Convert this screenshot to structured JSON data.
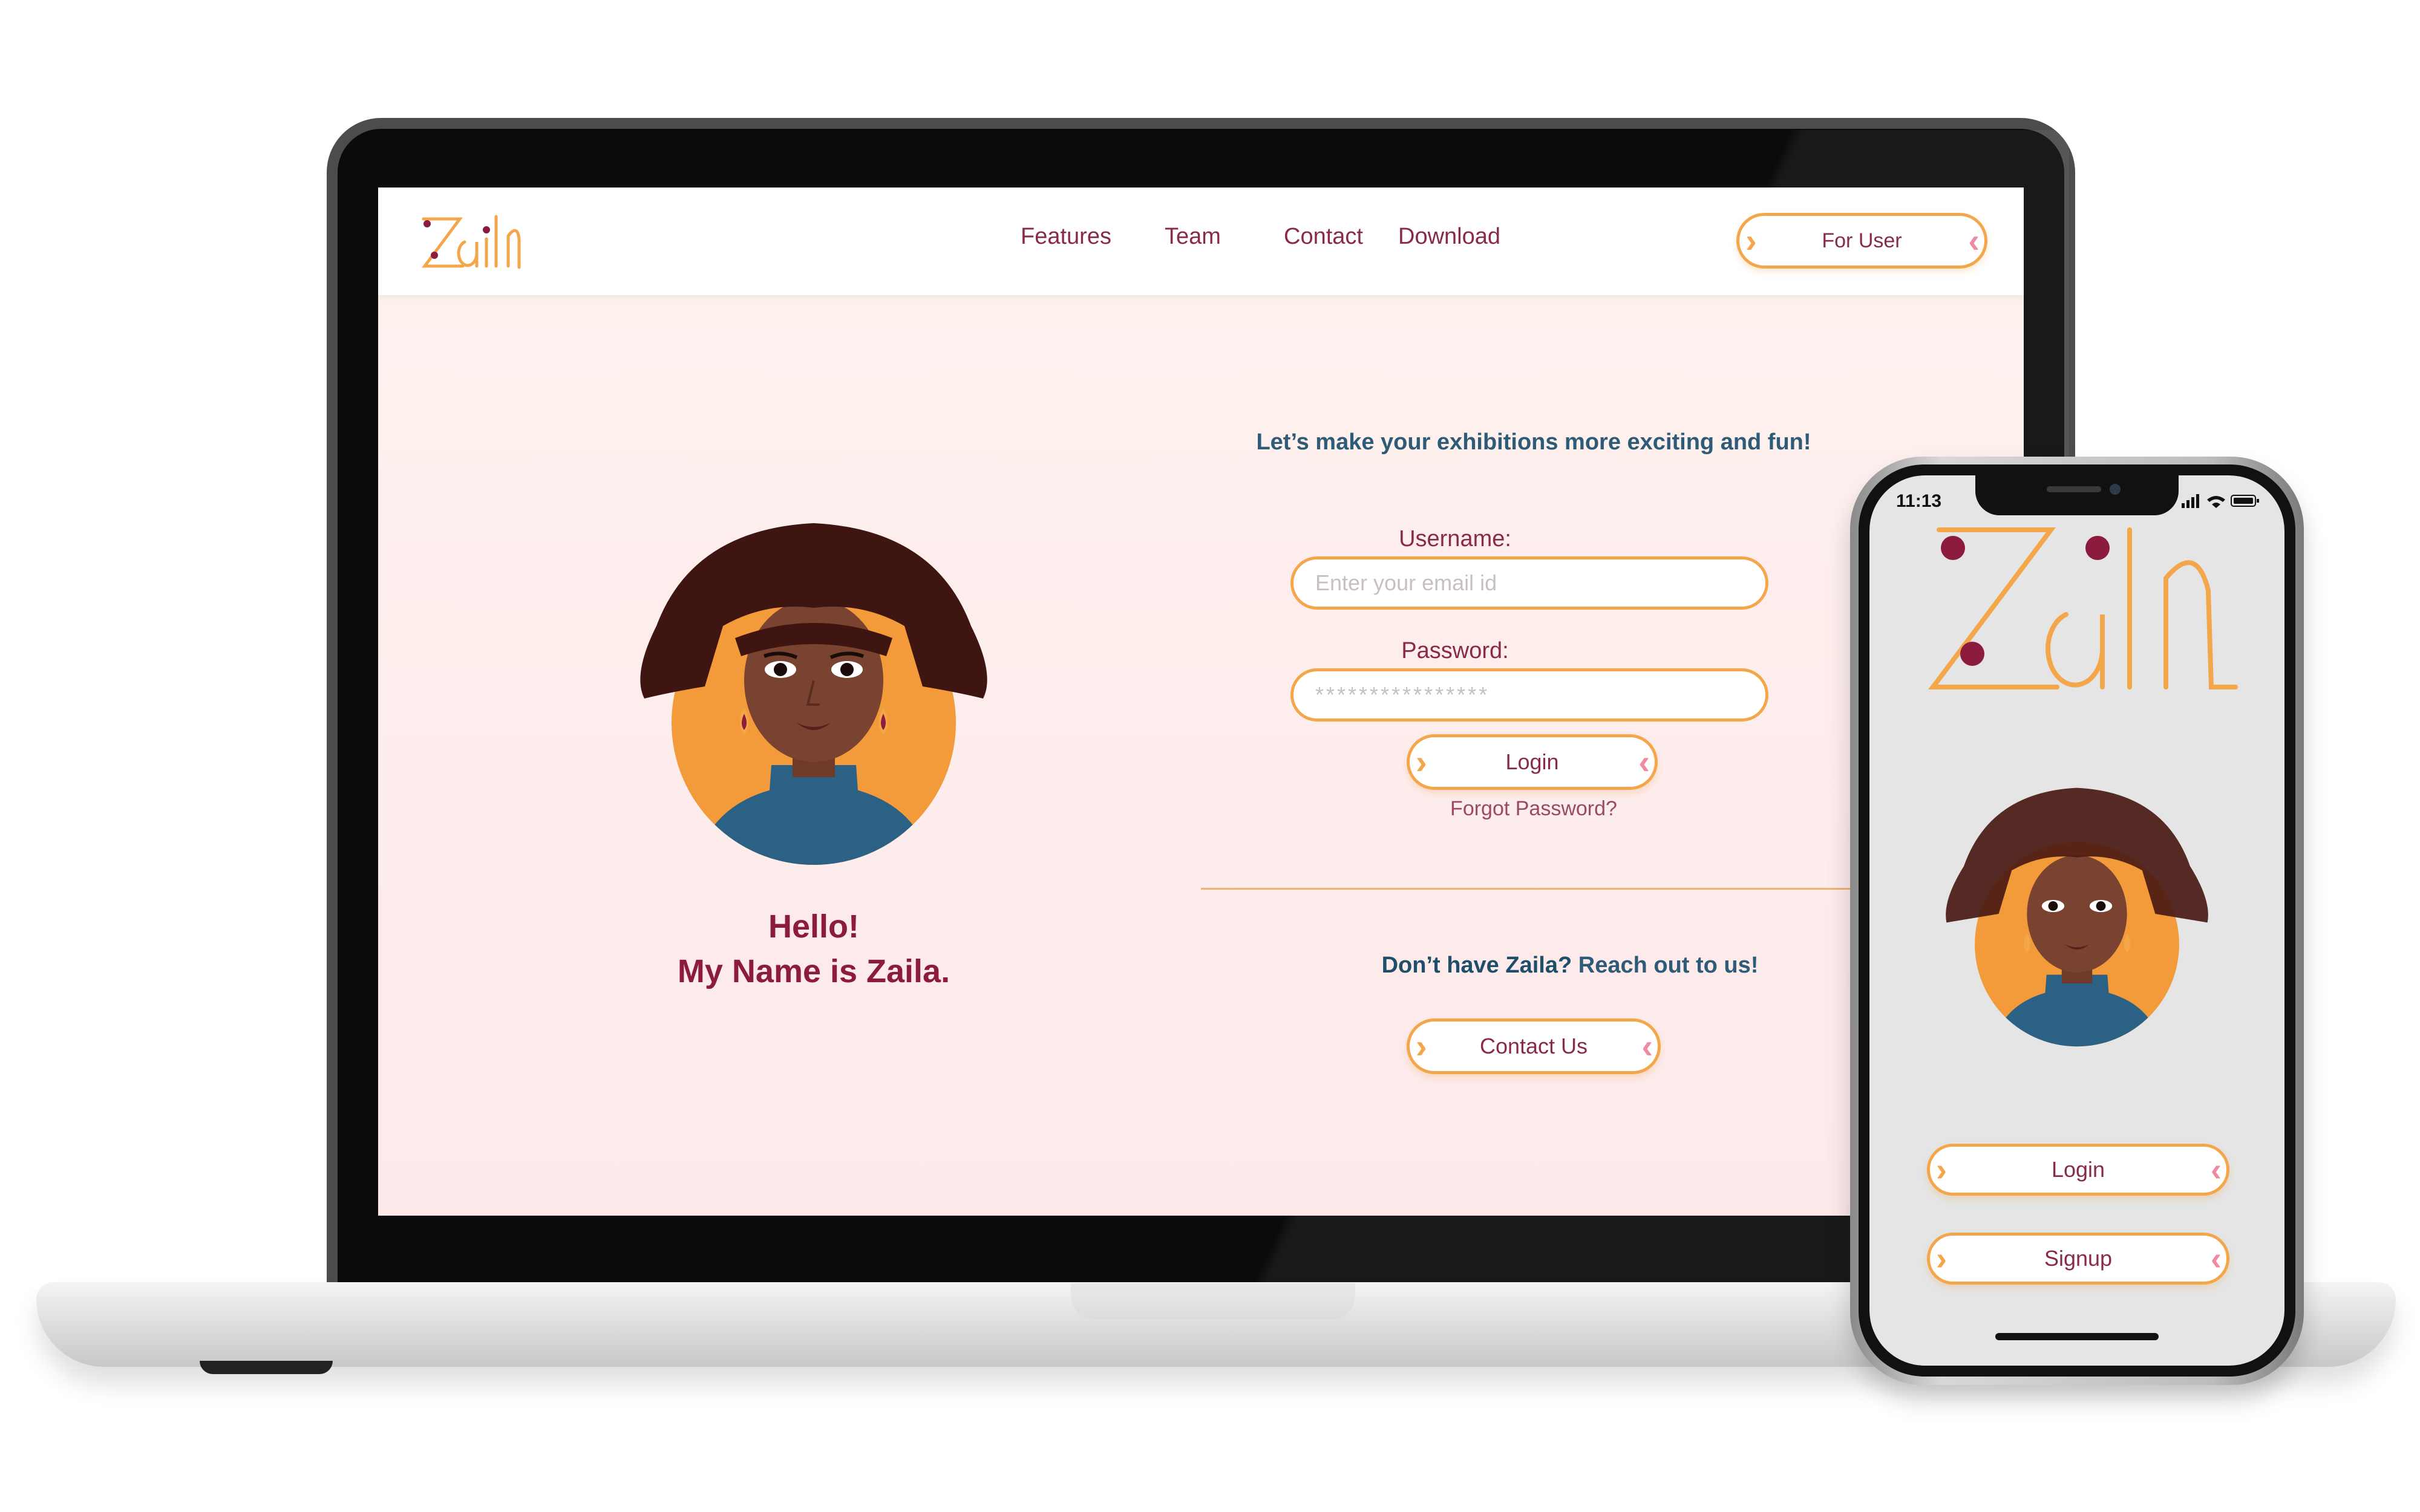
{
  "colors": {
    "brand_orange": "#f3a64a",
    "brand_maroon": "#8b1c3d",
    "accent_blue": "#2d5b78",
    "accent_pink": "#ef8aa0",
    "screen_bg": "#fdecec"
  },
  "website": {
    "logo_text": "Zaila",
    "nav": {
      "features": "Features",
      "team": "Team",
      "contact": "Contact",
      "download": "Download"
    },
    "for_user_label": "For User",
    "hero": {
      "hello": "Hello!",
      "name_line": "My Name is Zaila."
    },
    "form": {
      "tagline": "Let’s make your exhibitions more exciting and fun!",
      "username_label": "Username:",
      "username_placeholder": "Enter your email id",
      "password_label": "Password:",
      "password_value": "****************",
      "login_label": "Login",
      "forgot_label": "Forgot Password?"
    },
    "contact_section": {
      "prompt_part1": "Don’t have Zaila?",
      "prompt_part2": " Reach out to us!",
      "contact_button": "Contact Us"
    }
  },
  "phone": {
    "time": "11:13",
    "logo_text": "Zaila",
    "login_label": "Login",
    "signup_label": "Signup"
  }
}
